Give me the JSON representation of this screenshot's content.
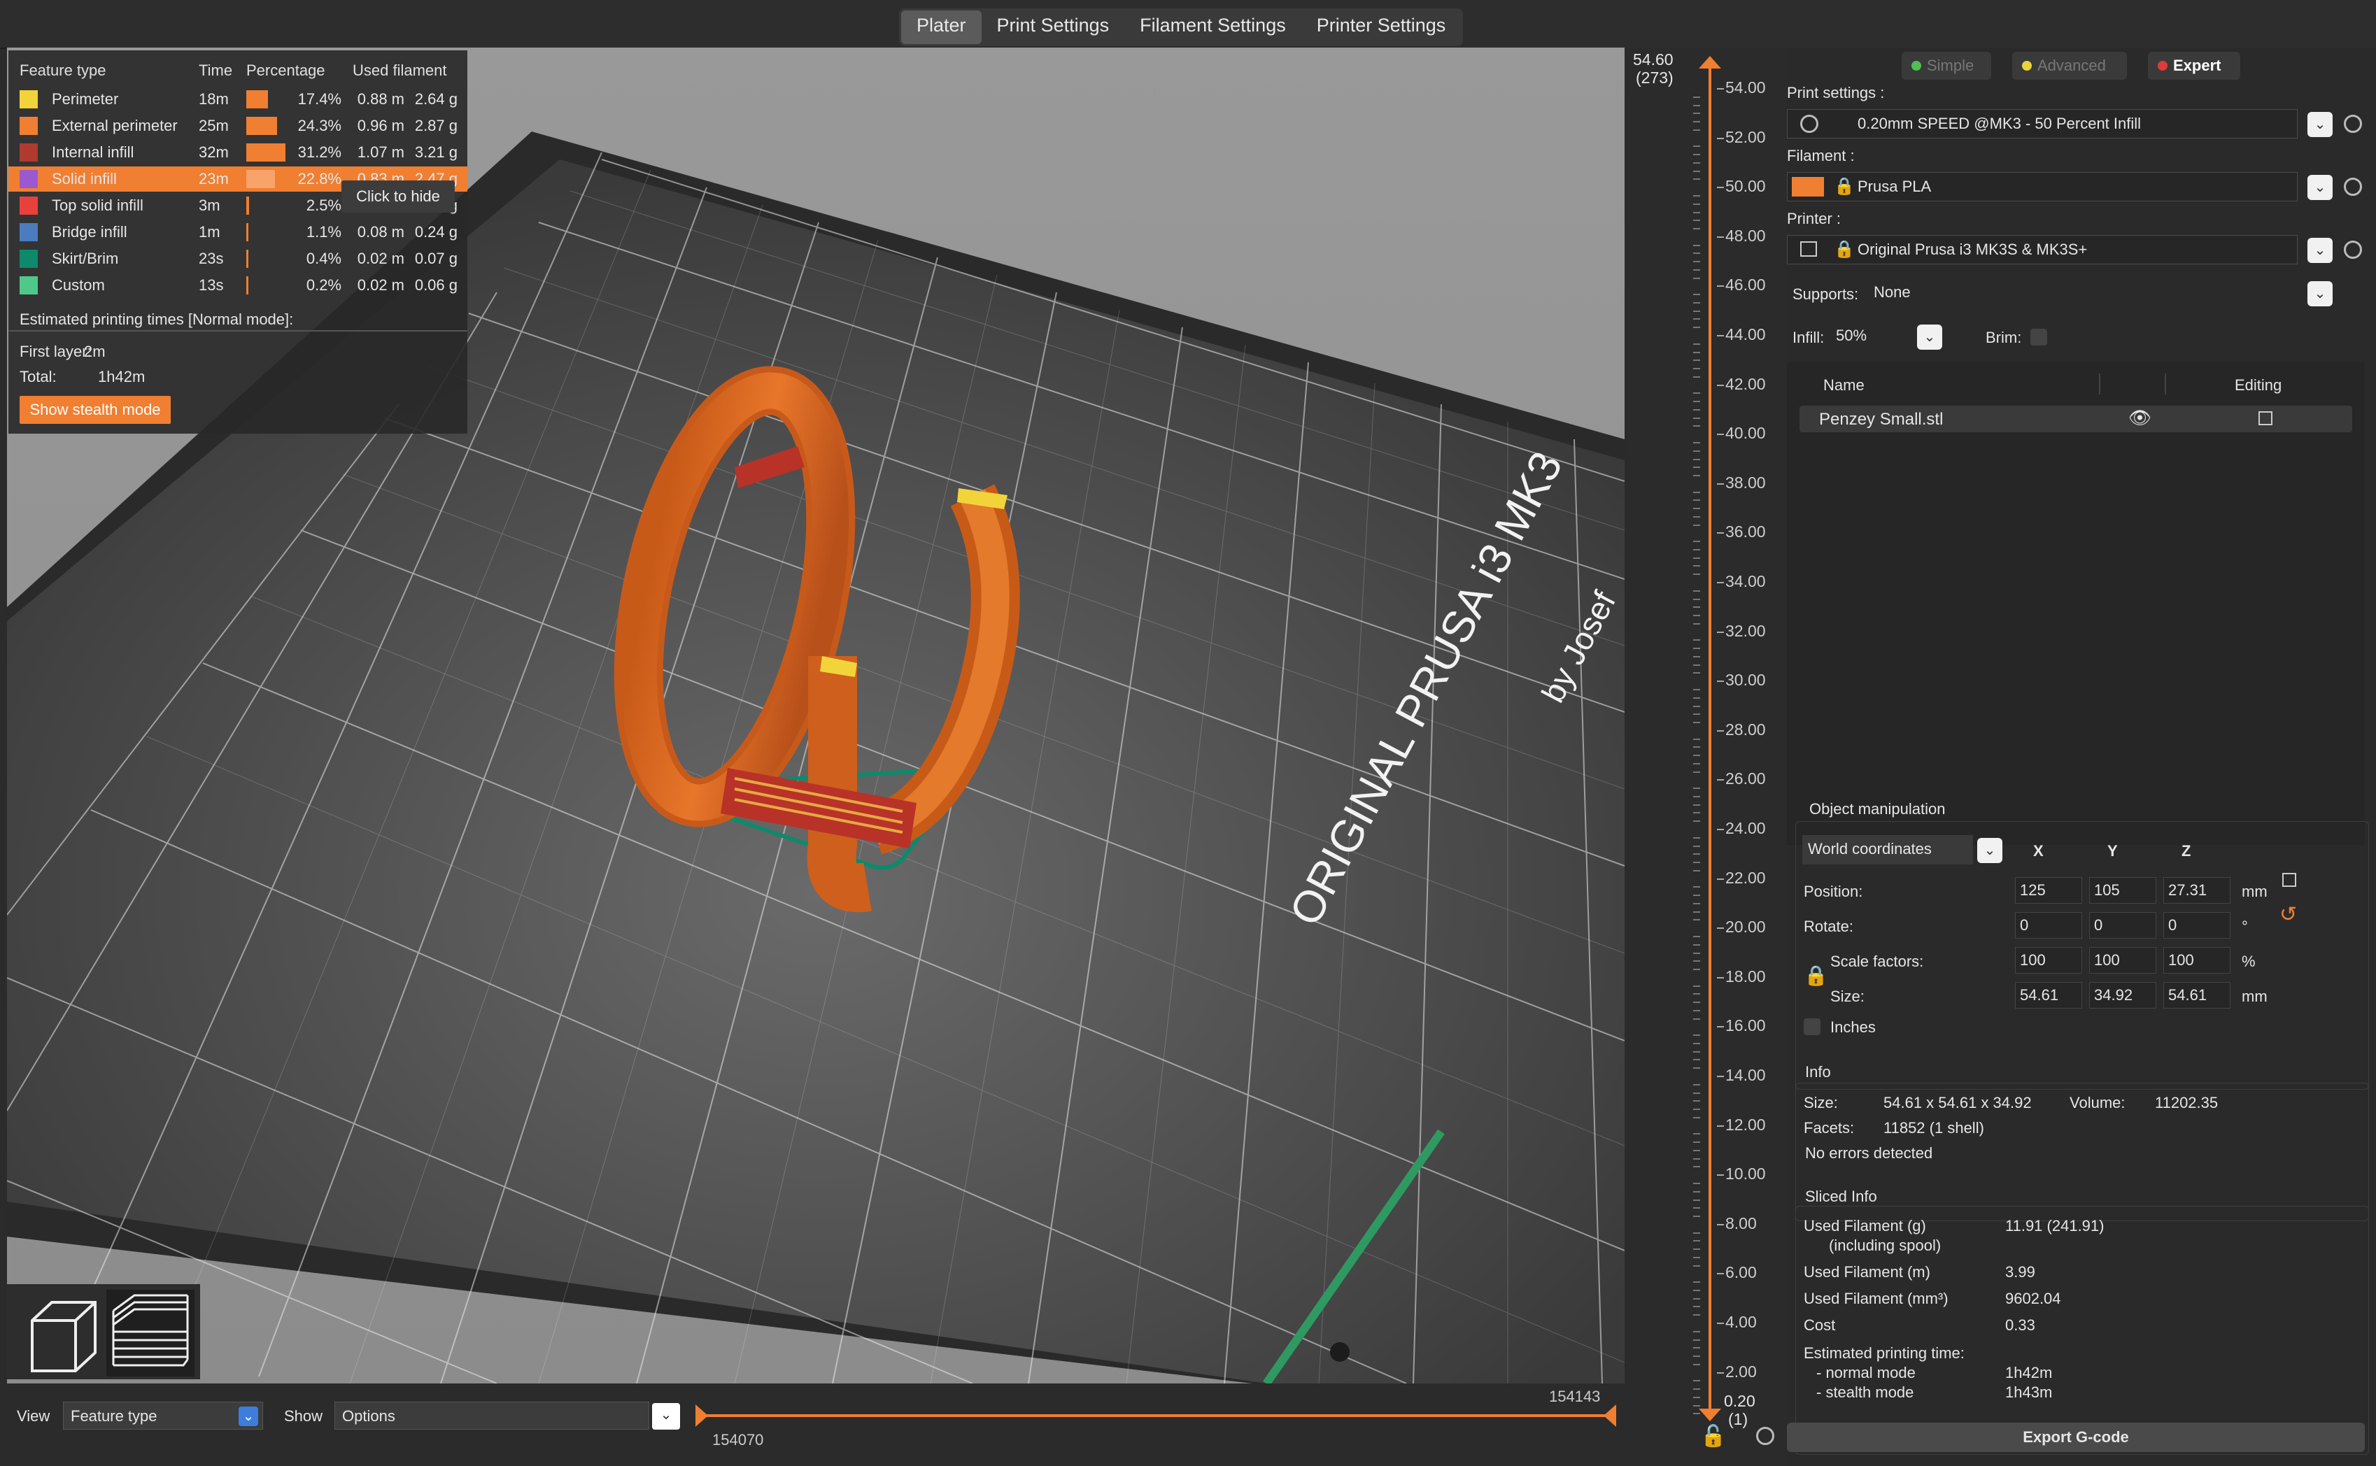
{
  "tabs": [
    {
      "label": "Plater",
      "active": true
    },
    {
      "label": "Print Settings"
    },
    {
      "label": "Filament Settings"
    },
    {
      "label": "Printer Settings"
    }
  ],
  "legend": {
    "headers": {
      "feature": "Feature type",
      "time": "Time",
      "percentage": "Percentage",
      "filament": "Used filament"
    },
    "rows": [
      {
        "name": "Perimeter",
        "color": "#f2d43a",
        "time": "18m",
        "pct": "17.4%",
        "pct_value": 17.4,
        "len": "0.88 m",
        "weight": "2.64 g"
      },
      {
        "name": "External perimeter",
        "color": "#f07f31",
        "time": "25m",
        "pct": "24.3%",
        "pct_value": 24.3,
        "len": "0.96 m",
        "weight": "2.87 g"
      },
      {
        "name": "Internal infill",
        "color": "#b03a2e",
        "time": "32m",
        "pct": "31.2%",
        "pct_value": 31.2,
        "len": "1.07 m",
        "weight": "3.21 g"
      },
      {
        "name": "Solid infill",
        "color": "#9b59d0",
        "time": "23m",
        "pct": "22.8%",
        "pct_value": 22.8,
        "len": "0.83 m",
        "weight": "2.47 g",
        "highlighted": true
      },
      {
        "name": "Top solid infill",
        "color": "#e8413c",
        "time": "3m",
        "pct": "2.5%",
        "pct_value": 2.5,
        "len": "0.09 m",
        "weight": "0.26 g"
      },
      {
        "name": "Bridge infill",
        "color": "#4b7cc0",
        "time": "1m",
        "pct": "1.1%",
        "pct_value": 1.1,
        "len": "0.08 m",
        "weight": "0.24 g"
      },
      {
        "name": "Skirt/Brim",
        "color": "#0d8a6b",
        "time": "23s",
        "pct": "0.4%",
        "pct_value": 0.4,
        "len": "0.02 m",
        "weight": "0.07 g"
      },
      {
        "name": "Custom",
        "color": "#4fc98a",
        "time": "13s",
        "pct": "0.2%",
        "pct_value": 0.2,
        "len": "0.02 m",
        "weight": "0.06 g"
      }
    ],
    "tooltip": "Click to hide",
    "estimated_title": "Estimated printing times [Normal mode]:",
    "first_layer_label": "First layer:",
    "first_layer_value": "2m",
    "total_label": "Total:",
    "total_value": "1h42m",
    "stealth_button": "Show stealth mode"
  },
  "bed": {
    "brand_text": "ORIGINAL PRUSA i3 MK3",
    "by_text": "by Josef"
  },
  "bottom": {
    "view_label": "View",
    "view_value": "Feature type",
    "show_label": "Show",
    "show_value": "Options",
    "h_slider_left": "154070",
    "h_slider_right": "154143"
  },
  "vslider": {
    "top_value": "54.60",
    "top_layer": "(273)",
    "bottom_value": "0.20",
    "bottom_layer": "(1)",
    "ticks": [
      "54.00",
      "52.00",
      "50.00",
      "48.00",
      "46.00",
      "44.00",
      "42.00",
      "40.00",
      "38.00",
      "36.00",
      "34.00",
      "32.00",
      "30.00",
      "28.00",
      "26.00",
      "24.00",
      "22.00",
      "20.00",
      "18.00",
      "16.00",
      "14.00",
      "12.00",
      "10.00",
      "8.00",
      "6.00",
      "4.00",
      "2.00"
    ]
  },
  "panel": {
    "modes": {
      "simple": "Simple",
      "advanced": "Advanced",
      "expert": "Expert"
    },
    "print_settings_label": "Print settings :",
    "print_settings_value": "0.20mm SPEED @MK3 - 50 Percent Infill",
    "filament_label": "Filament :",
    "filament_value": "Prusa PLA",
    "filament_color": "#f07f31",
    "printer_label": "Printer :",
    "printer_value": "Original Prusa i3 MK3S & MK3S+",
    "supports_label": "Supports:",
    "supports_value": "None",
    "infill_label": "Infill:",
    "infill_value": "50%",
    "brim_label": "Brim:",
    "list_headers": {
      "name": "Name",
      "editing": "Editing"
    },
    "objects": [
      {
        "name": "Penzey Small.stl"
      }
    ],
    "object_manipulation": {
      "title": "Object manipulation",
      "coords": "World coordinates",
      "axes": [
        "X",
        "Y",
        "Z"
      ],
      "position_label": "Position:",
      "position": [
        "125",
        "105",
        "27.31"
      ],
      "position_unit": "mm",
      "rotate_label": "Rotate:",
      "rotate": [
        "0",
        "0",
        "0"
      ],
      "rotate_unit": "°",
      "scale_label": "Scale factors:",
      "scale": [
        "100",
        "100",
        "100"
      ],
      "scale_unit": "%",
      "size_label": "Size:",
      "size": [
        "54.61",
        "34.92",
        "54.61"
      ],
      "size_unit": "mm",
      "inches_label": "Inches"
    },
    "info": {
      "title": "Info",
      "size_label": "Size:",
      "size_value": "54.61 x 54.61 x 34.92",
      "volume_label": "Volume:",
      "volume_value": "11202.35",
      "facets_label": "Facets:",
      "facets_value": "11852 (1 shell)",
      "errors": "No errors detected"
    },
    "sliced": {
      "title": "Sliced Info",
      "filament_g_label": "Used Filament (g)",
      "filament_g_sub": "(including spool)",
      "filament_g_value": "11.91 (241.91)",
      "filament_m_label": "Used Filament (m)",
      "filament_m_value": "3.99",
      "filament_mm3_label": "Used Filament (mm³)",
      "filament_mm3_value": "9602.04",
      "cost_label": "Cost",
      "cost_value": "0.33",
      "est_label": "Estimated printing time:",
      "normal_label": "- normal mode",
      "normal_value": "1h42m",
      "stealth_label": "- stealth mode",
      "stealth_value": "1h43m"
    },
    "export_button": "Export G-code"
  }
}
